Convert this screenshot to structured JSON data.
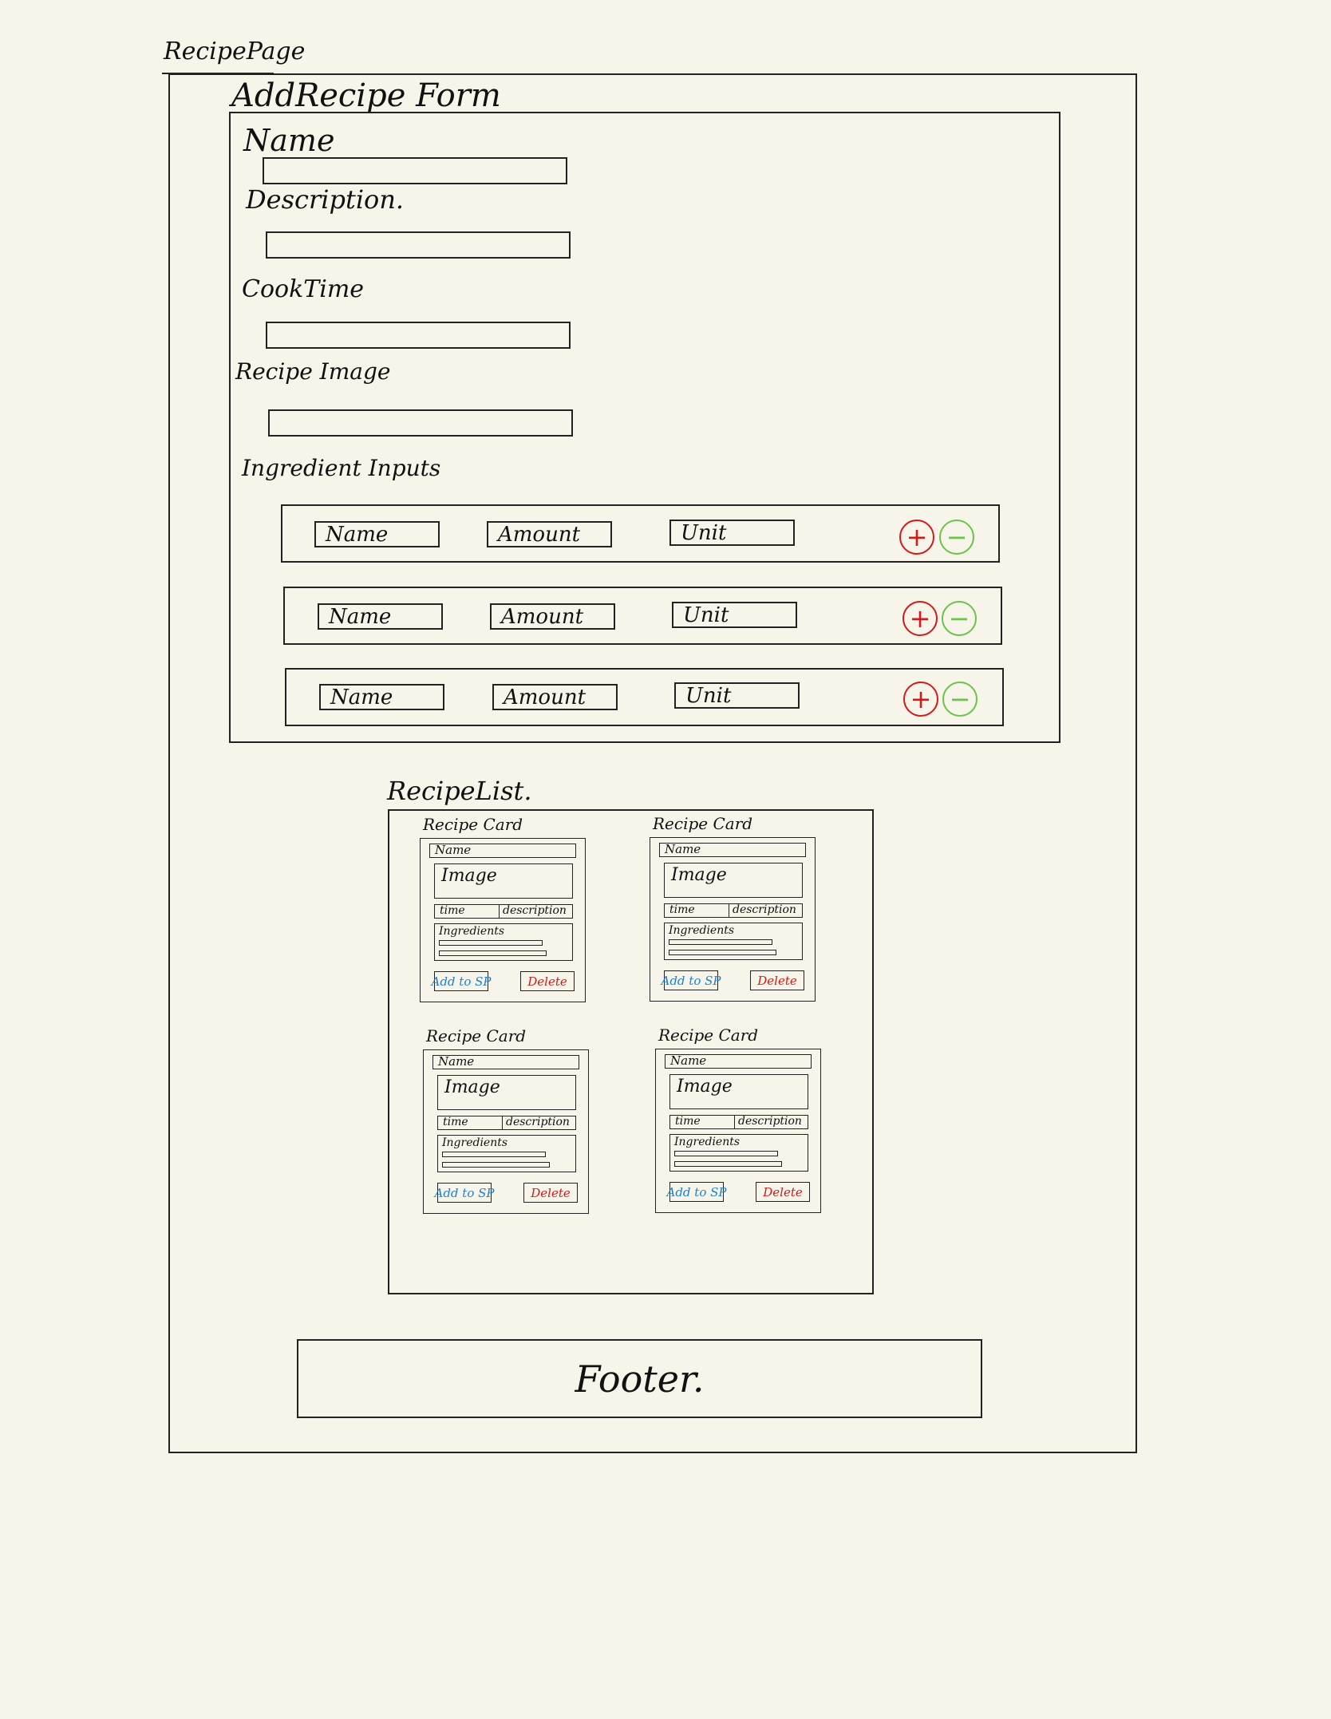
{
  "page": {
    "title": "RecipePage"
  },
  "form": {
    "title": "AddRecipe Form",
    "name_label": "Name",
    "description_label": "Description.",
    "cooktime_label": "CookTime",
    "image_label": "Recipe Image",
    "ingredients_label": "Ingredient Inputs",
    "ingredient_rows": [
      {
        "name": "Name",
        "amount": "Amount",
        "unit": "Unit"
      },
      {
        "name": "Name",
        "amount": "Amount",
        "unit": "Unit"
      },
      {
        "name": "Name",
        "amount": "Amount",
        "unit": "Unit"
      }
    ]
  },
  "list": {
    "title": "RecipeList.",
    "cards": [
      {
        "title": "Recipe Card",
        "name": "Name",
        "image": "Image",
        "time": "time",
        "description": "description",
        "ingredients": "Ingredients",
        "add_button": "Add to SP",
        "delete_button": "Delete"
      },
      {
        "title": "Recipe Card",
        "name": "Name",
        "image": "Image",
        "time": "time",
        "description": "description",
        "ingredients": "Ingredients",
        "add_button": "Add to SP",
        "delete_button": "Delete"
      },
      {
        "title": "Recipe Card",
        "name": "Name",
        "image": "Image",
        "time": "time",
        "description": "description",
        "ingredients": "Ingredients",
        "add_button": "Add to SP",
        "delete_button": "Delete"
      },
      {
        "title": "Recipe Card",
        "name": "Name",
        "image": "Image",
        "time": "time",
        "description": "description",
        "ingredients": "Ingredients",
        "add_button": "Add to SP",
        "delete_button": "Delete"
      }
    ]
  },
  "footer": {
    "label": "Footer."
  },
  "colors": {
    "plus": "#d11a1a",
    "minus": "#6cc24a",
    "add_button": "#1e7fd6",
    "delete_button": "#d11a1a",
    "ink": "#222222",
    "paper": "#f7f5ea"
  },
  "icons": {
    "plus": "plus-circle-icon",
    "minus": "minus-circle-icon"
  }
}
